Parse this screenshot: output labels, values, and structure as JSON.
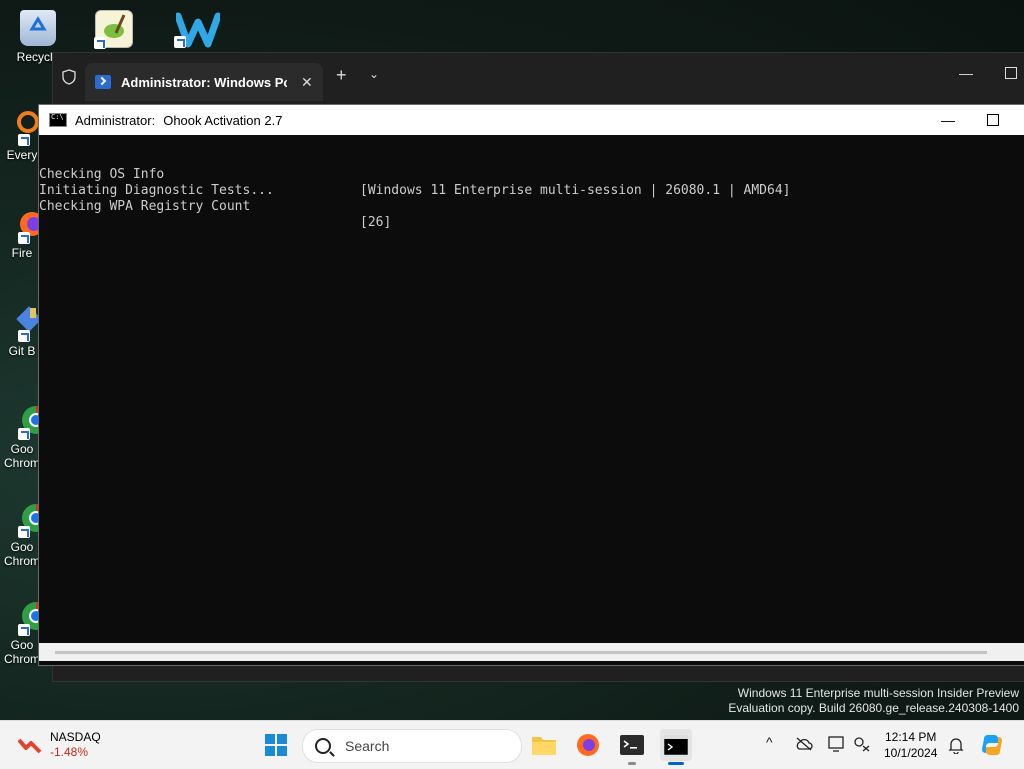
{
  "desktop": {
    "icons": [
      {
        "label": "Recycle",
        "icon": "recycle-bin-icon"
      },
      {
        "label": "",
        "icon": "notepad-plus-icon"
      },
      {
        "label": "",
        "icon": "w-app-icon"
      },
      {
        "label": "Every",
        "icon": "everything-icon"
      },
      {
        "label": "Fire",
        "icon": "firefox-icon"
      },
      {
        "label": "Git B",
        "icon": "git-bash-icon"
      },
      {
        "label": "Goo\nChrom",
        "icon": "chrome-icon"
      },
      {
        "label": "Goo\nChrom",
        "icon": "chrome-icon"
      },
      {
        "label": "Goo\nChrom",
        "icon": "chrome-icon"
      }
    ]
  },
  "terminal": {
    "tab_title": "Administrator: Windows Powe",
    "close_glyph": "✕",
    "new_tab_glyph": "+",
    "dropdown_glyph": "⌄",
    "minimize_glyph": "—"
  },
  "console": {
    "title_left": "Administrator:",
    "title_right": "Ohook Activation 2.7",
    "minimize_glyph": "—",
    "lines": [
      {
        "left": "Checking OS Info",
        "right": "[Windows 11 Enterprise multi-session | 26080.1 | AMD64]"
      },
      {
        "left": "Initiating Diagnostic Tests...",
        "right": ""
      },
      {
        "left": "Checking WPA Registry Count",
        "right": "[26]"
      }
    ]
  },
  "watermark": {
    "line1": "Windows 11 Enterprise multi-session Insider Preview",
    "line2": "Evaluation copy. Build 26080.ge_release.240308-1400"
  },
  "taskbar": {
    "stock_name": "NASDAQ",
    "stock_change": "-1.48%",
    "search_placeholder": "Search",
    "time": "12:14 PM",
    "date": "10/1/2024",
    "tray_chevron": "^",
    "colors": {
      "accent": "#0067c0",
      "stock_down": "#c42b1c"
    }
  }
}
